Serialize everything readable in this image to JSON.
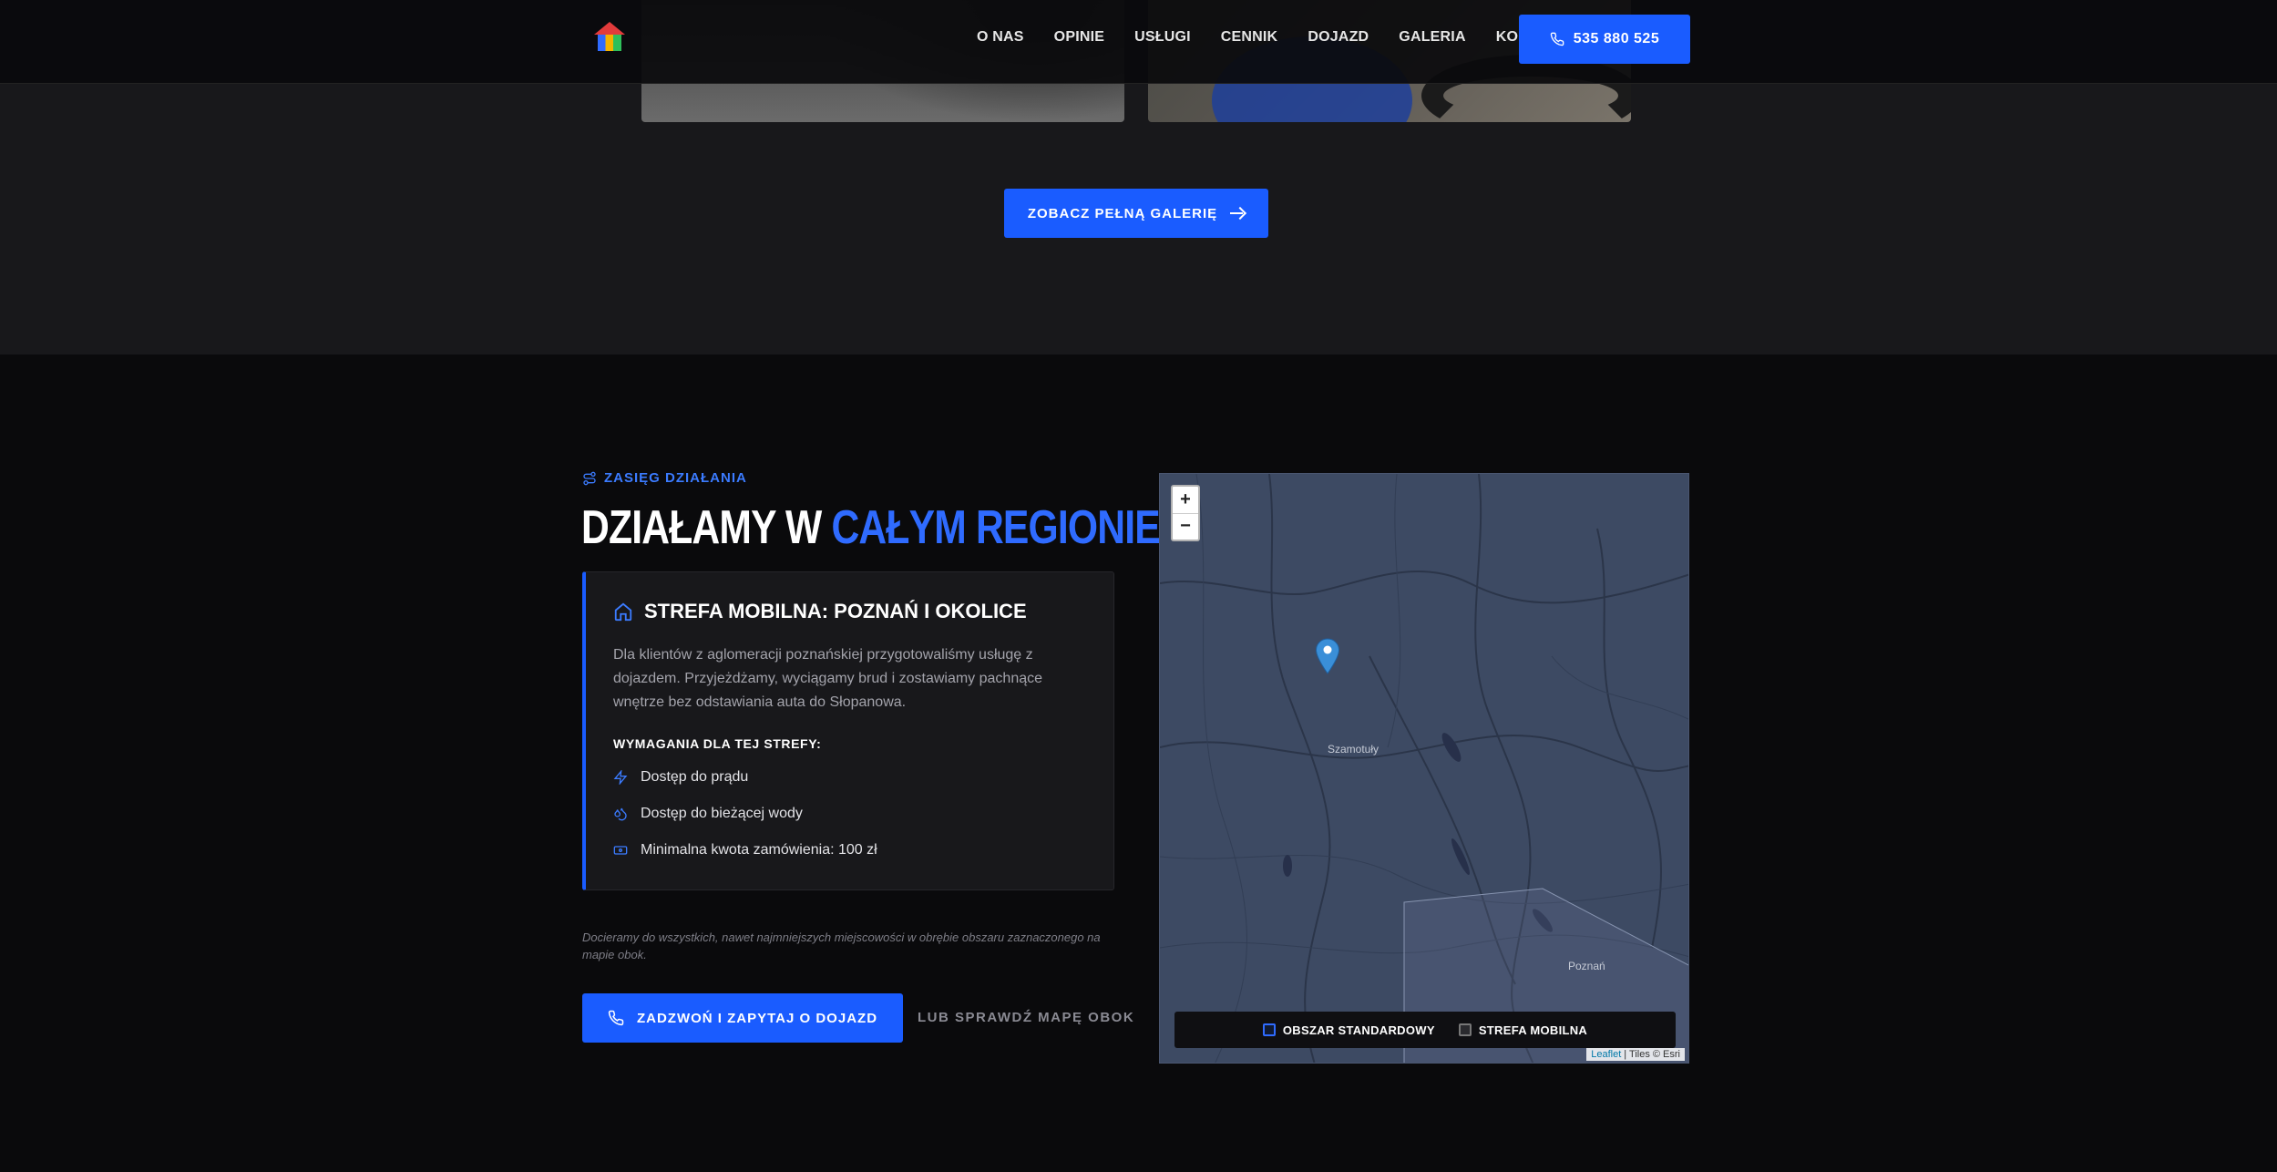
{
  "header": {
    "nav": [
      "O NAS",
      "OPINIE",
      "USŁUGI",
      "CENNIK",
      "DOJAZD",
      "GALERIA",
      "KONTAKT"
    ],
    "phone_label": "535 880 525"
  },
  "gallery": {
    "button_label": "ZOBACZ PEŁNĄ GALERIĘ"
  },
  "region": {
    "eyebrow": "ZASIĘG DZIAŁANIA",
    "heading_main": "DZIAŁAMY W",
    "heading_accent": "CAŁYM REGIONIE",
    "zone": {
      "title": "STREFA MOBILNA: POZNAŃ I OKOLICE",
      "description": "Dla klientów z aglomeracji poznańskiej przygotowaliśmy usługę z dojazdem. Przyjeżdżamy, wyciągamy brud i zostawiamy pachnące wnętrze bez odstawiania auta do Słopanowa.",
      "requirements_title": "WYMAGANIA DLA TEJ STREFY:",
      "requirements": [
        "Dostęp do prądu",
        "Dostęp do bieżącej wody",
        "Minimalna kwota zamówienia: 100 zł"
      ]
    },
    "note": "Docieramy do wszystkich, nawet najmniejszych miejscowości w obrębie obszaru zaznaczonego na mapie obok.",
    "call_button": "ZADZWOŃ I ZAPYTAJ O DOJAZD",
    "map_link": "LUB SPRAWDŹ MAPĘ OBOK"
  },
  "map": {
    "zoom_in": "+",
    "zoom_out": "−",
    "cities": [
      "Szamotuły",
      "Poznań"
    ],
    "legend": [
      "OBSZAR STANDARDOWY",
      "STREFA MOBILNA"
    ],
    "attribution_leaflet": "Leaflet",
    "attribution_tiles": " | Tiles © Esri"
  },
  "colors": {
    "accent": "#1a5cff",
    "accent_text": "#2f6bff",
    "bg_dark": "#0a0a0c",
    "bg_card": "#18181b"
  }
}
